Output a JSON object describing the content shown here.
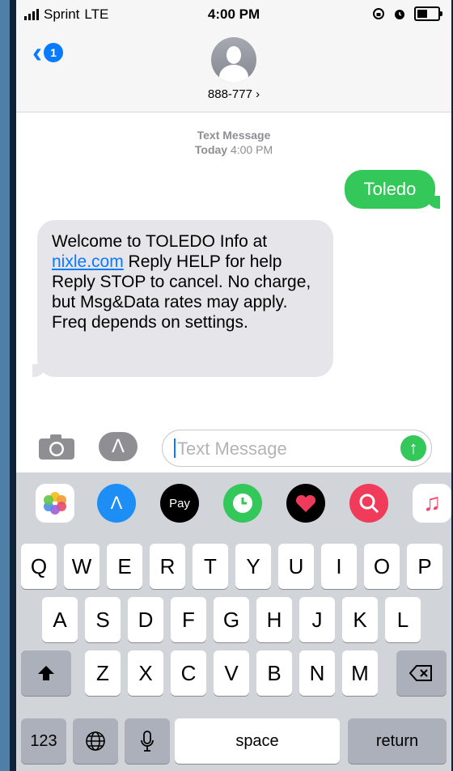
{
  "status_bar": {
    "carrier": "Sprint",
    "network": "LTE",
    "time": "4:00 PM"
  },
  "header": {
    "back_badge": "1",
    "contact": "888-777 ›"
  },
  "conversation": {
    "service_label": "Text Message",
    "date_label": "Today",
    "time_label": "4:00 PM",
    "outgoing": "Toledo",
    "incoming_pre": "Welcome to TOLEDO Info at ",
    "incoming_link": "nixle.com",
    "incoming_post": " Reply HELP for help Reply STOP to cancel. No charge, but Msg&Data rates may apply. Freq depends on settings."
  },
  "composer": {
    "placeholder": "Text Message"
  },
  "app_strip": [
    "photos-icon",
    "app-store-icon",
    "apple-pay-icon",
    "clock-icon",
    "heart-icon",
    "globe-search-icon",
    "music-icon"
  ],
  "app_labels": {
    "apple_pay": "Pay"
  },
  "keyboard": {
    "row1": [
      "Q",
      "W",
      "E",
      "R",
      "T",
      "Y",
      "U",
      "I",
      "O",
      "P"
    ],
    "row2": [
      "A",
      "S",
      "D",
      "F",
      "G",
      "H",
      "J",
      "K",
      "L"
    ],
    "row3": [
      "Z",
      "X",
      "C",
      "V",
      "B",
      "N",
      "M"
    ],
    "numbers": "123",
    "space": "space",
    "return": "return"
  },
  "colors": {
    "imessage_green": "#34c759",
    "ios_blue": "#0a7aff",
    "bubble_gray": "#e5e5ea"
  }
}
